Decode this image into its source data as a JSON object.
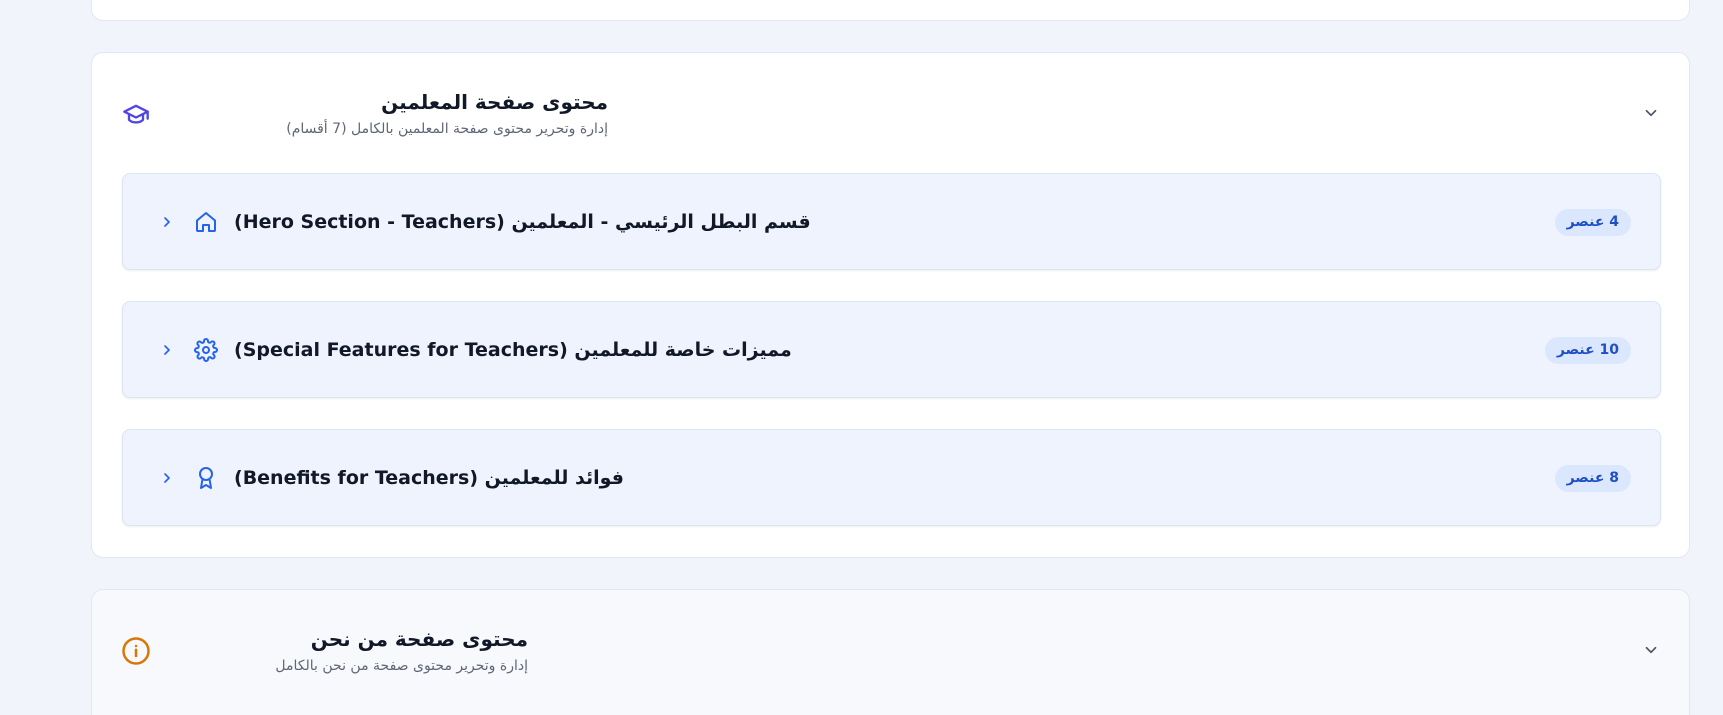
{
  "teachers_card": {
    "title": "محتوى صفحة المعلمين",
    "subtitle": "إدارة وتحرير محتوى صفحة المعلمين بالكامل (7 أقسام)",
    "icon": "graduation-cap-icon",
    "sections": [
      {
        "title": "قسم البطل الرئيسي - المعلمين (Hero Section - Teachers)",
        "badge": "4 عنصر",
        "icon": "home-icon"
      },
      {
        "title": "مميزات خاصة للمعلمين (Special Features for Teachers)",
        "badge": "10 عنصر",
        "icon": "gear-icon"
      },
      {
        "title": "فوائد للمعلمين (Benefits for Teachers)",
        "badge": "8 عنصر",
        "icon": "award-icon"
      }
    ]
  },
  "about_card": {
    "title": "محتوى صفحة من نحن",
    "subtitle": "إدارة وتحرير محتوى صفحة من نحن بالكامل",
    "icon": "info-icon"
  },
  "colors": {
    "accent_purple": "#4f46e5",
    "accent_blue": "#2563eb",
    "info_orange": "#d97706",
    "badge_bg": "#dbe7fd",
    "section_bg": "#eef3fd"
  }
}
